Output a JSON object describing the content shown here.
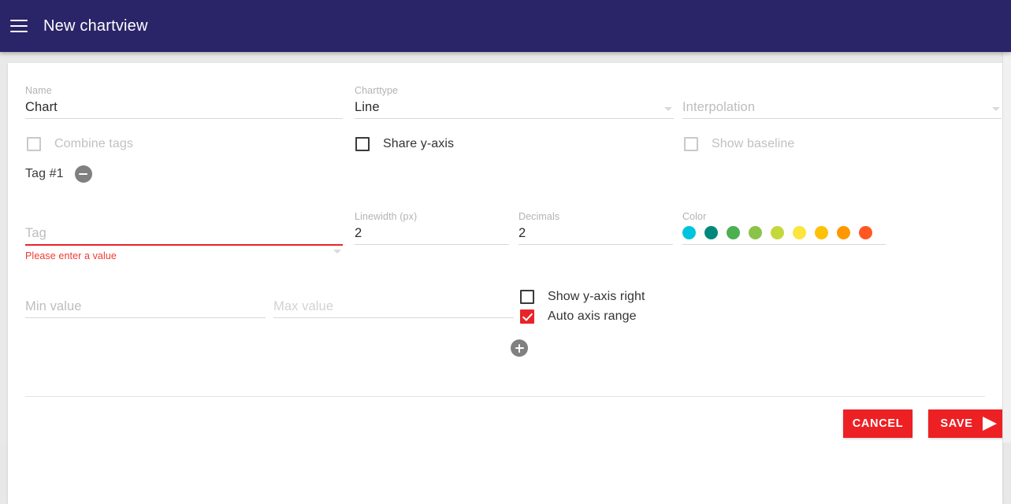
{
  "appbar": {
    "menu_icon": "hamburger-icon",
    "title": "New chartview"
  },
  "form": {
    "name": {
      "label": "Name",
      "value": "Chart"
    },
    "charttype": {
      "label": "Charttype",
      "value": "Line"
    },
    "interpolation": {
      "label": "Interpolation",
      "placeholder": "Interpolation",
      "value": ""
    },
    "combine_tags": {
      "label": "Combine tags",
      "checked": false,
      "disabled": true
    },
    "share_y_axis": {
      "label": "Share y-axis",
      "checked": false,
      "disabled": false
    },
    "show_baseline": {
      "label": "Show baseline",
      "checked": false,
      "disabled": true
    }
  },
  "tag": {
    "title": "Tag #1",
    "remove_icon": "minus-circle-icon",
    "add_icon": "plus-circle-icon",
    "tag_field": {
      "placeholder": "Tag",
      "value": "",
      "error": "Please enter a value"
    },
    "linewidth": {
      "label": "Linewidth (px)",
      "value": "2"
    },
    "decimals": {
      "label": "Decimals",
      "value": "2"
    },
    "color": {
      "label": "Color",
      "swatches": [
        "#00c4de",
        "#00897b",
        "#4caf50",
        "#8bc34a",
        "#c3d83a",
        "#fbe53e",
        "#ffc107",
        "#ff9800",
        "#ff5722"
      ]
    },
    "min_value": {
      "placeholder": "Min value",
      "value": ""
    },
    "max_value": {
      "placeholder": "Max value",
      "value": ""
    },
    "show_y_axis_right": {
      "label": "Show y-axis right",
      "checked": false
    },
    "auto_axis_range": {
      "label": "Auto axis range",
      "checked": true
    }
  },
  "actions": {
    "cancel": "CANCEL",
    "save": "SAVE",
    "save_icon": "send-icon"
  },
  "theme": {
    "appbar_bg": "#2a2468",
    "accent": "#ed2024",
    "error": "#ef3b33"
  }
}
